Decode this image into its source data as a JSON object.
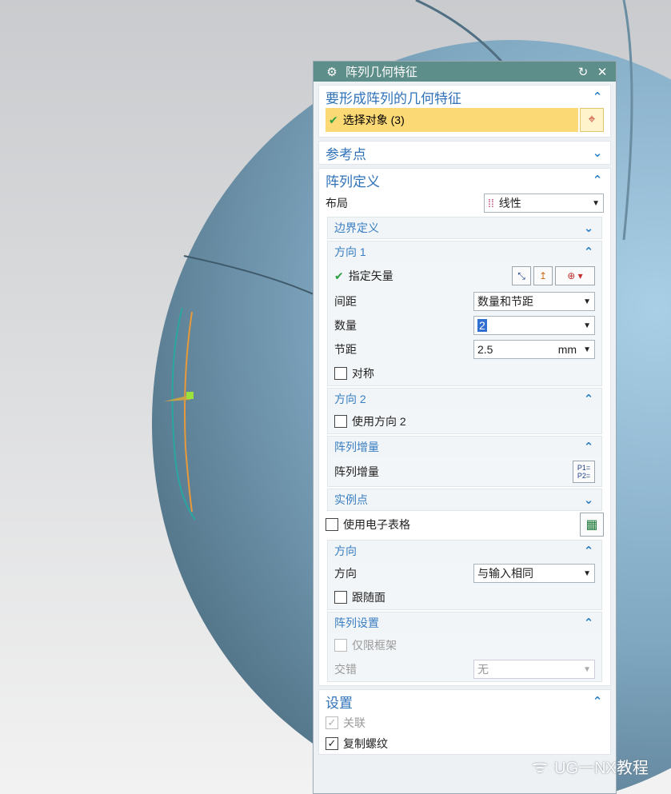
{
  "dialog": {
    "title": "阵列几何特征",
    "icons": {
      "gear": "gear-icon",
      "reset": "reset-icon",
      "close": "close-icon"
    }
  },
  "section_select": {
    "title": "要形成阵列的几何特征",
    "select_label": "选择对象 (3)"
  },
  "section_ref": {
    "title": "参考点"
  },
  "section_def": {
    "title": "阵列定义",
    "layout_label": "布局",
    "layout_value": "线性",
    "boundary": {
      "title": "边界定义"
    },
    "dir1": {
      "title": "方向 1",
      "vector_label": "指定矢量",
      "spacing_label": "间距",
      "spacing_value": "数量和节距",
      "count_label": "数量",
      "count_value": "2",
      "pitch_label": "节距",
      "pitch_value": "2.5",
      "pitch_unit": "mm",
      "symmetric_label": "对称"
    },
    "dir2": {
      "title": "方向 2",
      "use_label": "使用方向 2"
    },
    "increment": {
      "title": "阵列增量",
      "label": "阵列增量"
    },
    "instance": {
      "title": "实例点"
    },
    "spreadsheet_label": "使用电子表格",
    "orient": {
      "title": "方向",
      "label": "方向",
      "value": "与输入相同",
      "follow_label": "跟随面"
    },
    "settings": {
      "title": "阵列设置",
      "frame_label": "仅限框架",
      "stagger_label": "交错",
      "stagger_value": "无"
    }
  },
  "section_settings": {
    "title": "设置",
    "assoc_label": "关联",
    "copy_thread_label": "复制螺纹"
  },
  "watermark": "UG一NX教程",
  "colors": {
    "title_bar": "#5e8e8a",
    "selection": "#fbd975",
    "accent": "#2f72b8"
  }
}
